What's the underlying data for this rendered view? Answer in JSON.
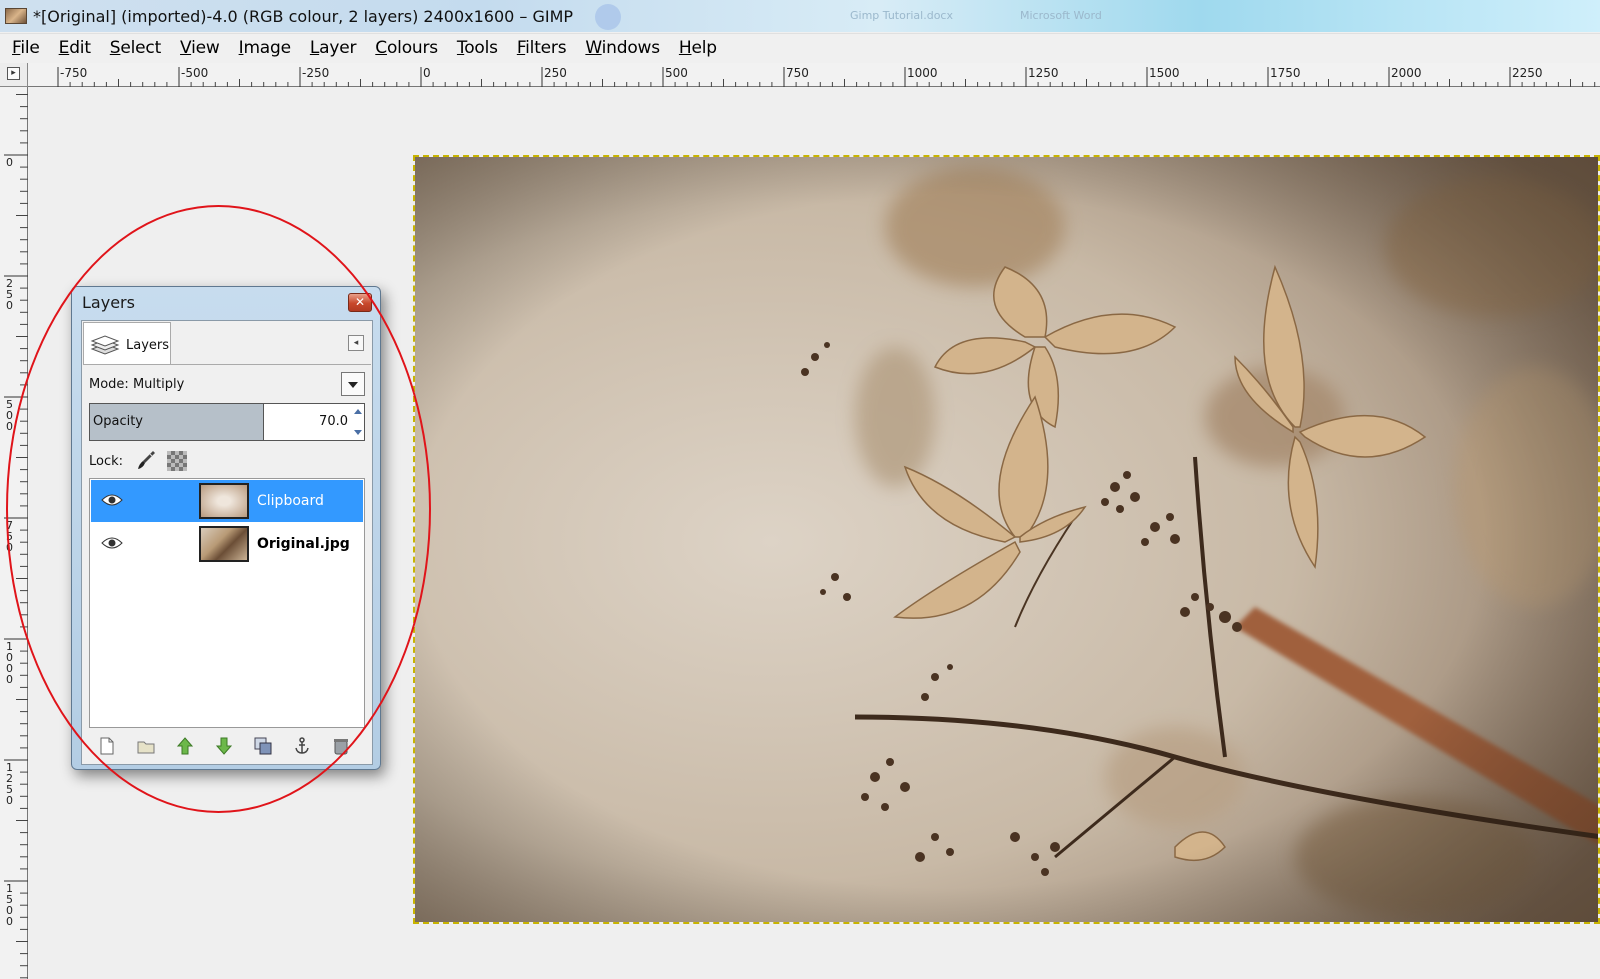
{
  "window": {
    "title": "*[Original] (imported)-4.0 (RGB colour, 2 layers) 2400x1600 – GIMP",
    "background_taskbar_labels": [
      "Gimp Tutorial.docx",
      "Microsoft Word"
    ]
  },
  "menubar": {
    "items": [
      "File",
      "Edit",
      "Select",
      "View",
      "Image",
      "Layer",
      "Colours",
      "Tools",
      "Filters",
      "Windows",
      "Help"
    ]
  },
  "rulers": {
    "horizontal_labels": [
      "-750",
      "-500",
      "-250",
      "0",
      "250",
      "500",
      "750",
      "1000",
      "1250",
      "1500",
      "1750",
      "2000",
      "2250"
    ],
    "vertical_labels": [
      "0",
      "250",
      "500",
      "750",
      "1000",
      "1250",
      "1500"
    ],
    "corner_icon": "navigate-icon"
  },
  "layers_dialog": {
    "title": "Layers",
    "tab_label": "Layers",
    "mode_label": "Mode:",
    "mode_value": "Multiply",
    "opacity_label": "Opacity",
    "opacity_value": "70.0",
    "opacity_fraction": 0.7,
    "lock_label": "Lock:",
    "layers": [
      {
        "name": "Clipboard",
        "visible": true,
        "selected": true
      },
      {
        "name": "Original.jpg",
        "visible": true,
        "selected": false
      }
    ],
    "actions": [
      "new-layer-icon",
      "new-layer-group-icon",
      "raise-layer-icon",
      "lower-layer-icon",
      "duplicate-layer-icon",
      "anchor-layer-icon",
      "delete-layer-icon"
    ]
  },
  "colors": {
    "selection_blue": "#3399ff",
    "annotation_red": "#e0141a",
    "canvas_bg": "#efefef",
    "selection_dash": "#c8b400"
  }
}
